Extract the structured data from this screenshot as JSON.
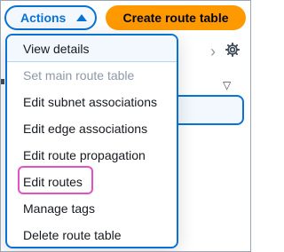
{
  "toolbar": {
    "actions_label": "Actions",
    "create_label": "Create route table"
  },
  "menu": {
    "items": [
      {
        "label": "View details",
        "state": "hover"
      },
      {
        "label": "Set main route table",
        "state": "disabled"
      },
      {
        "label": "Edit subnet associations",
        "state": "normal"
      },
      {
        "label": "Edit edge associations",
        "state": "normal"
      },
      {
        "label": "Edit route propagation",
        "state": "normal"
      },
      {
        "label": "Edit routes",
        "state": "highlighted"
      },
      {
        "label": "Manage tags",
        "state": "normal"
      },
      {
        "label": "Delete route table",
        "state": "normal"
      }
    ]
  },
  "colors": {
    "accent": "#0972d3",
    "primary_button": "#ff9900",
    "highlight_outline": "#e352c5",
    "disabled_text": "#8d99a8"
  },
  "icons": [
    "caret-up-icon",
    "chevron-right-icon",
    "gear-icon",
    "sort-down-icon"
  ]
}
